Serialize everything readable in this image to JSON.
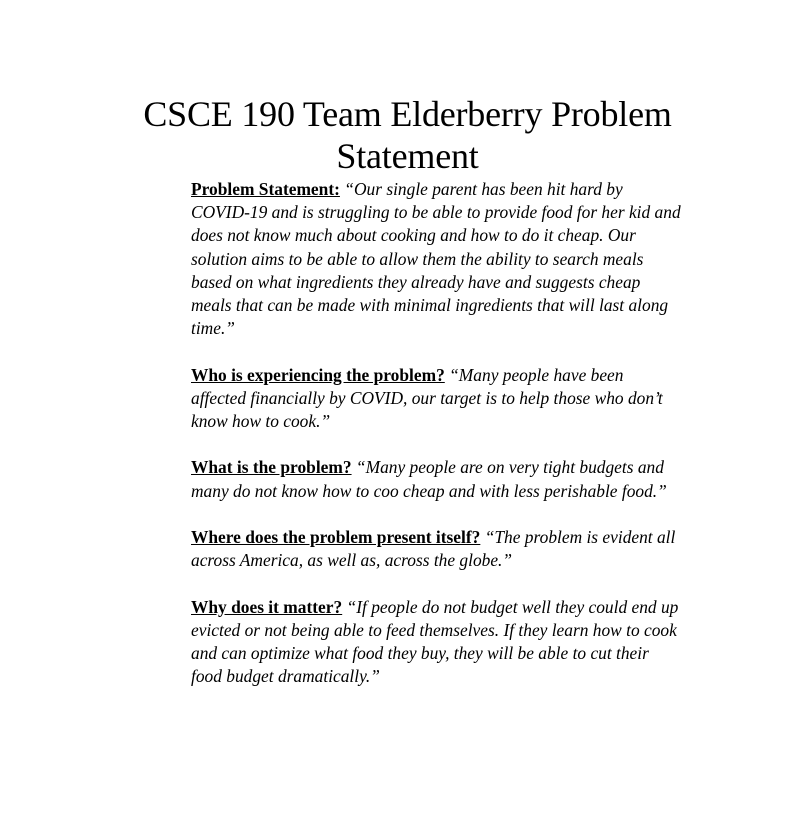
{
  "document": {
    "title_line1": "CSCE 190 Team Elderberry Problem",
    "title_line2": "Statement",
    "sections": [
      {
        "label": "Problem Statement:",
        "lines": [
          "“Our single parent has been hit hard by",
          "COVID-19 and is struggling to be able to provide food for her kid and",
          "does not know much about cooking and how to do it cheap. Our",
          "solution aims to be able to allow them the ability to search meals",
          "based on what ingredients they already have and suggests cheap",
          "meals that can be made with minimal ingredients that will last along",
          "time.”"
        ]
      },
      {
        "label": "Who is experiencing the problem?",
        "lines": [
          "“Many people have been",
          "affected financially by COVID, our target is to help those who don’t",
          "know how to cook.”"
        ]
      },
      {
        "label": "What is the problem?",
        "lines": [
          "“Many people are on very tight budgets and",
          "many do not know how to coo cheap and with less perishable food.”"
        ]
      },
      {
        "label": "Where does the problem present itself?",
        "lines": [
          "“The problem is evident all",
          "across America, as well as, across the globe.”"
        ]
      },
      {
        "label": "Why does it matter?",
        "lines": [
          "“If people do not budget well they could end up",
          "evicted or not being able to feed themselves. If they learn how to cook",
          "and can optimize what food they buy, they will be able to cut their",
          "food budget dramatically.”"
        ]
      }
    ]
  }
}
